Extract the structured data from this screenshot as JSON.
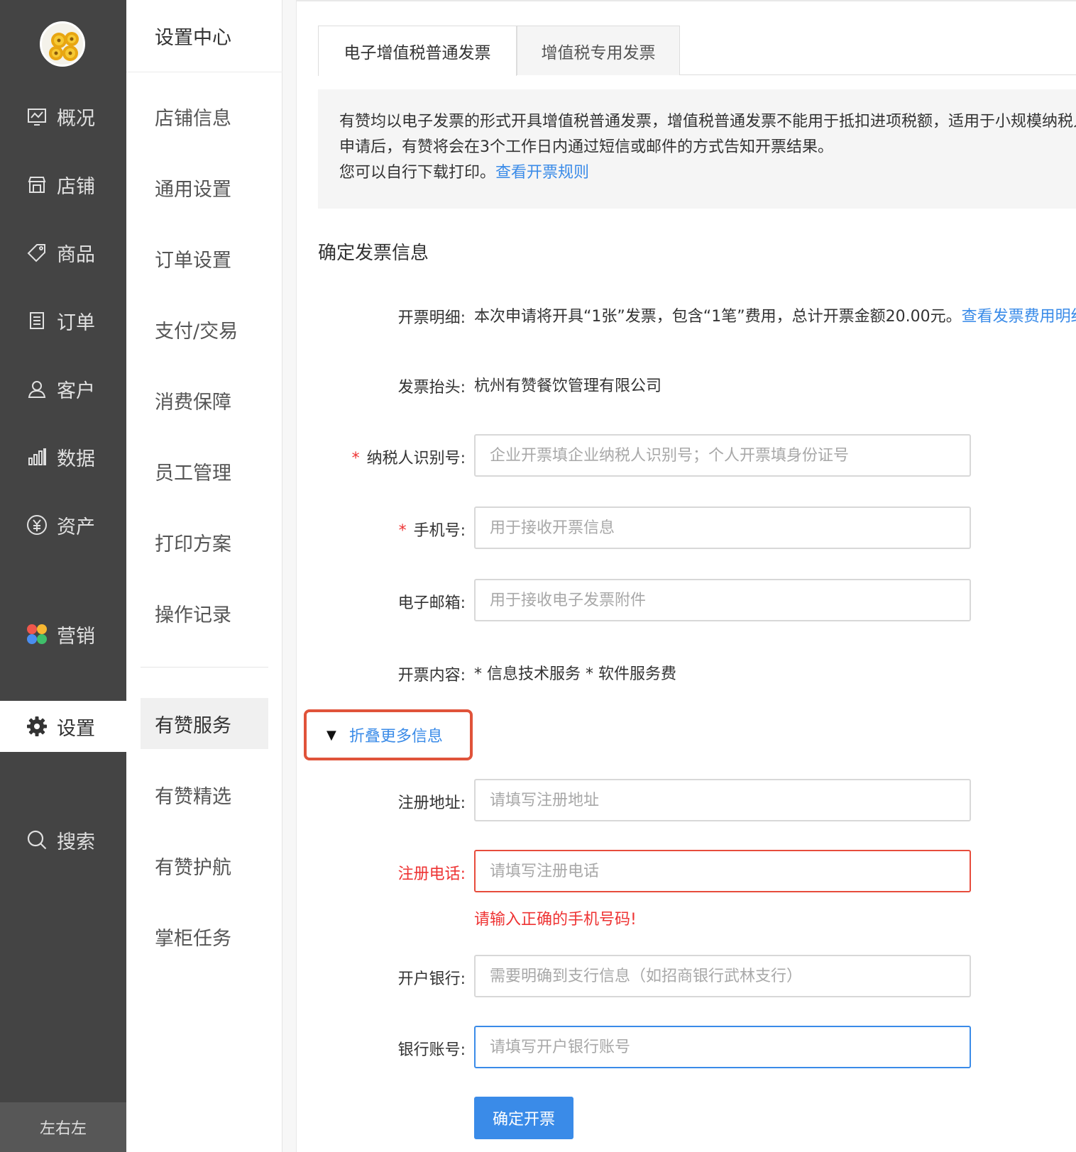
{
  "primary_nav": {
    "items": [
      {
        "label": "概况",
        "icon": "overview-icon"
      },
      {
        "label": "店铺",
        "icon": "store-icon"
      },
      {
        "label": "商品",
        "icon": "tag-icon"
      },
      {
        "label": "订单",
        "icon": "order-icon"
      },
      {
        "label": "客户",
        "icon": "user-icon"
      },
      {
        "label": "数据",
        "icon": "bar-chart-icon"
      },
      {
        "label": "资产",
        "icon": "yuan-icon"
      },
      {
        "label": "营销",
        "icon": "marketing-icon"
      },
      {
        "label": "设置",
        "icon": "gear-icon"
      },
      {
        "label": "搜索",
        "icon": "search-icon"
      }
    ],
    "user_name": "左右左"
  },
  "secondary_nav": {
    "title": "设置中心",
    "items": [
      "店铺信息",
      "通用设置",
      "订单设置",
      "支付/交易",
      "消费保障",
      "员工管理",
      "打印方案",
      "操作记录"
    ],
    "service_items": [
      "有赞服务",
      "有赞精选",
      "有赞护航",
      "掌柜任务"
    ]
  },
  "tabs": [
    "电子增值税普通发票",
    "增值税专用发票"
  ],
  "notice": {
    "line1": "有赞均以电子发票的形式开具增值税普通发票，增值税普通发票不能用于抵扣进项税额，适用于小规模纳税人。",
    "line2": "申请后，有赞将会在3个工作日内通过短信或邮件的方式告知开票结果。",
    "line3": "您可以自行下载打印。",
    "link": "查看开票规则"
  },
  "section_title": "确定发票信息",
  "detail": {
    "label": "开票明细:",
    "text": "本次申请将开具“1张”发票，包含“1笔”费用，总计开票金额20.00元。",
    "link": "查看发票费用明细"
  },
  "invoice_title": {
    "label": "发票抬头:",
    "value": "杭州有赞餐饮管理有限公司"
  },
  "tax_id": {
    "label": "纳税人识别号:",
    "placeholder": "企业开票填企业纳税人识别号；个人开票填身份证号"
  },
  "phone": {
    "label": "手机号:",
    "placeholder": "用于接收开票信息"
  },
  "email": {
    "label": "电子邮箱:",
    "placeholder": "用于接收电子发票附件"
  },
  "content": {
    "label": "开票内容:",
    "value": "* 信息技术服务 * 软件服务费"
  },
  "collapse": {
    "label": "折叠更多信息"
  },
  "reg_address": {
    "label": "注册地址:",
    "placeholder": "请填写注册地址"
  },
  "reg_phone": {
    "label": "注册电话:",
    "placeholder": "请填写注册电话",
    "error": "请输入正确的手机号码!"
  },
  "bank": {
    "label": "开户银行:",
    "placeholder": "需要明确到支行信息（如招商银行武林支行）"
  },
  "account": {
    "label": "银行账号:",
    "placeholder": "请填写开户银行账号"
  },
  "submit_label": "确定开票",
  "colors": {
    "accent": "#3a8be8",
    "error": "#e33333",
    "sidebar": "#444444",
    "highlight_box": "#e0533a"
  }
}
